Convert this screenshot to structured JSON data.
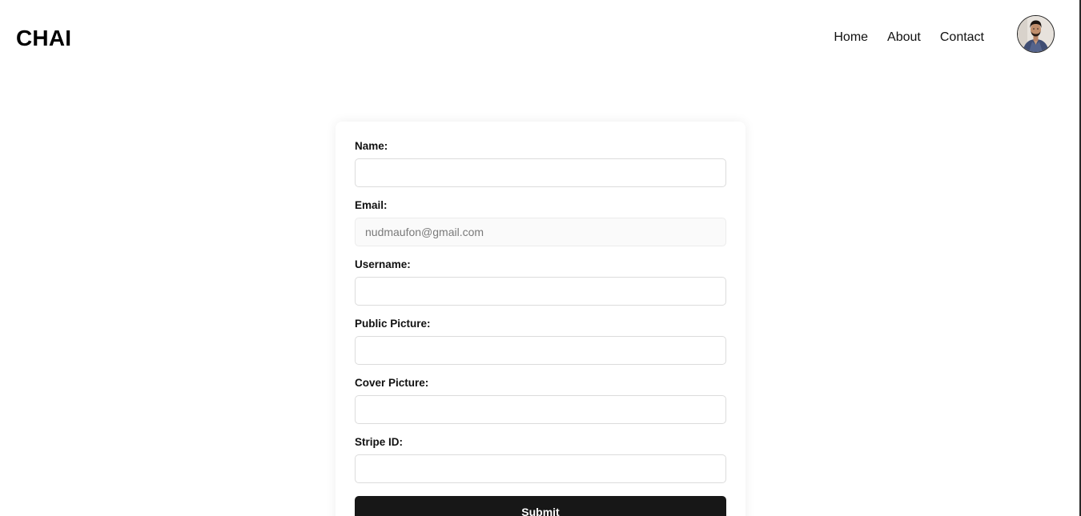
{
  "navbar": {
    "brand": "CHAI",
    "links": [
      {
        "label": "Home"
      },
      {
        "label": "About"
      },
      {
        "label": "Contact"
      }
    ]
  },
  "form": {
    "fields": [
      {
        "label": "Name:",
        "value": "",
        "placeholder": ""
      },
      {
        "label": "Email:",
        "value": "",
        "placeholder": "nudmaufon@gmail.com"
      },
      {
        "label": "Username:",
        "value": "",
        "placeholder": ""
      },
      {
        "label": "Public Picture:",
        "value": "",
        "placeholder": ""
      },
      {
        "label": "Cover Picture:",
        "value": "",
        "placeholder": ""
      },
      {
        "label": "Stripe ID:",
        "value": "",
        "placeholder": ""
      }
    ],
    "submit_label": "Submit"
  },
  "colors": {
    "button_bg": "#171717",
    "button_text": "#ffffff",
    "input_border": "#dcdcdc",
    "disabled_input_bg": "#fafafa"
  },
  "icons": {
    "avatar": "user-avatar-photo"
  }
}
